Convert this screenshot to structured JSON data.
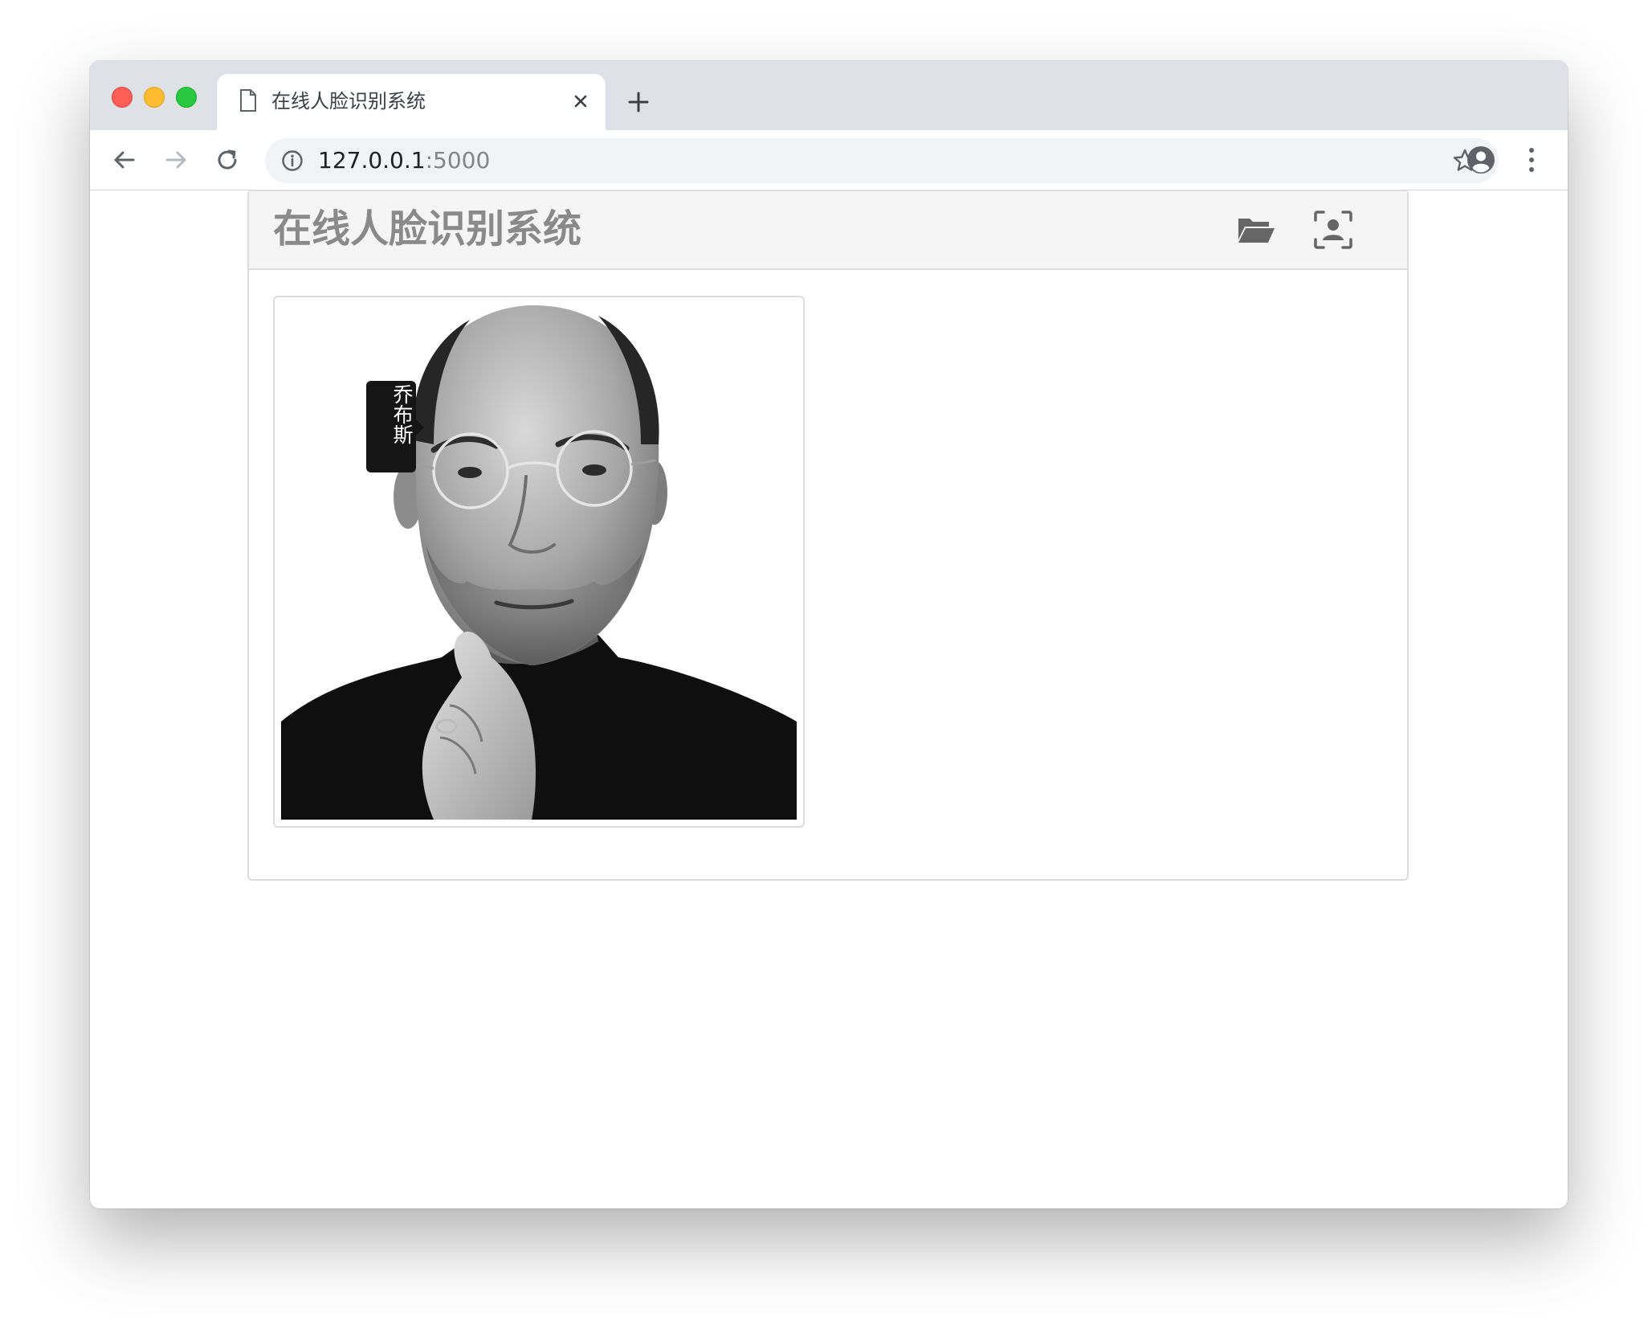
{
  "browser": {
    "tab_title": "在线人脸识别系统",
    "url_host": "127.0.0.1",
    "url_port": ":5000"
  },
  "app": {
    "title": "在线人脸识别系统",
    "icons": [
      "folder-open-icon",
      "face-scan-icon"
    ]
  },
  "recognition": {
    "face_label": "乔布斯"
  },
  "colors": {
    "tabstrip": "#dee1e6",
    "card_header": "#f5f5f5",
    "title_text": "#8a8a8a",
    "label_bg": "#151515"
  }
}
